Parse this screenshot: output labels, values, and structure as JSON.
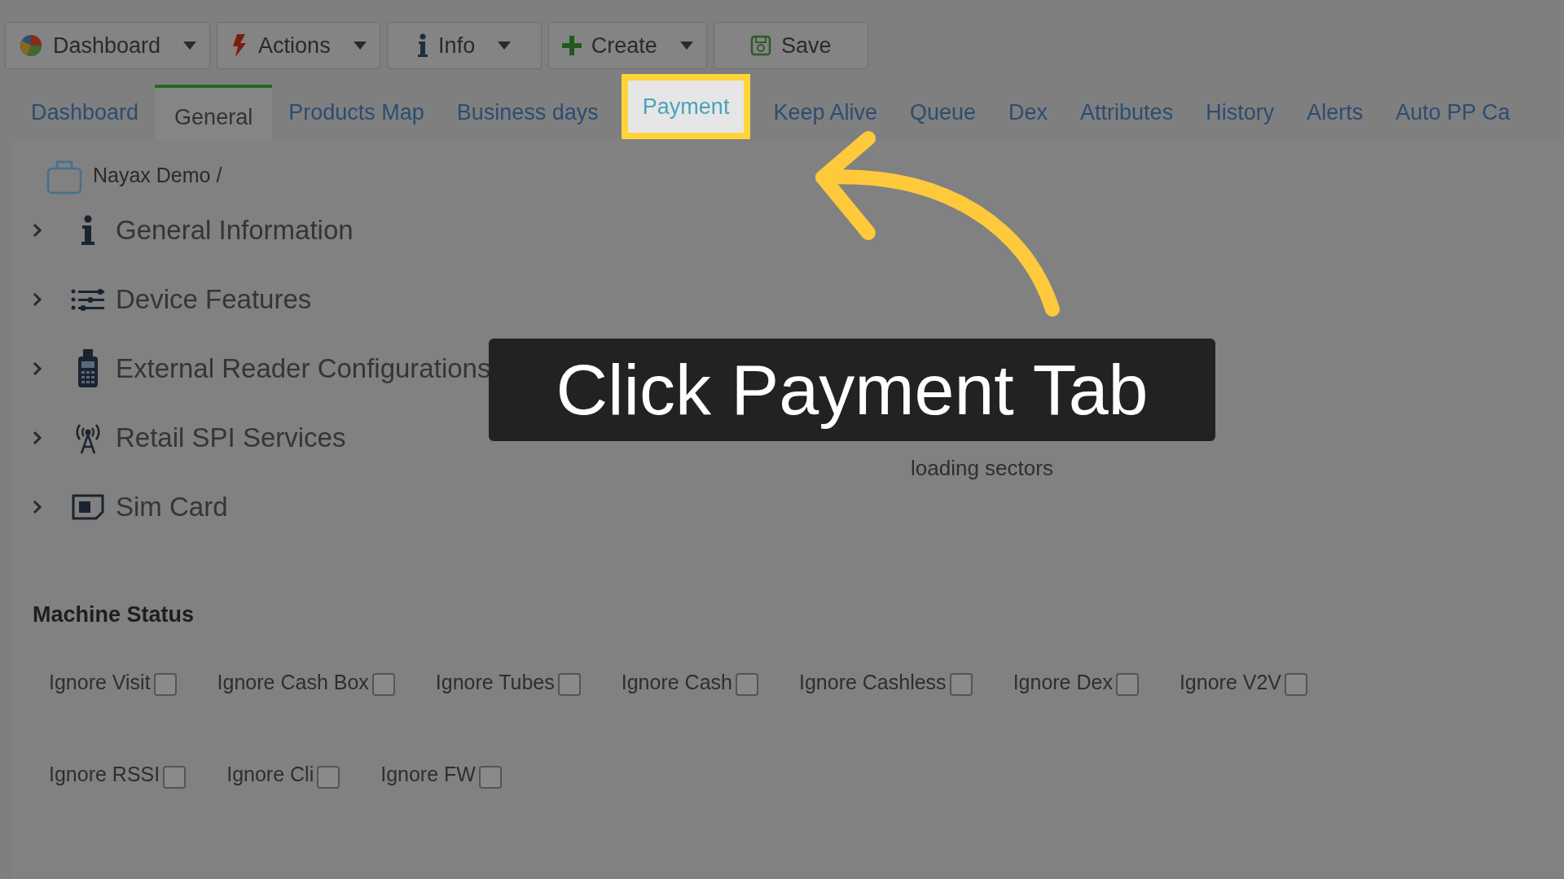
{
  "toolbar": [
    {
      "label": "Dashboard",
      "kind": "chart",
      "has_menu": true
    },
    {
      "label": "Actions",
      "kind": "bolt",
      "has_menu": true
    },
    {
      "label": "Info",
      "kind": "info",
      "has_menu": true
    },
    {
      "label": "Create",
      "kind": "plus",
      "has_menu": true
    },
    {
      "label": "Save",
      "kind": "save",
      "has_menu": false
    }
  ],
  "tabs": [
    {
      "label": "Dashboard",
      "selected": false,
      "highlighted": false
    },
    {
      "label": "General",
      "selected": true,
      "highlighted": false
    },
    {
      "label": "Products Map",
      "selected": false,
      "highlighted": false
    },
    {
      "label": "Business days",
      "selected": false,
      "highlighted": false
    },
    {
      "label": "Payment",
      "selected": false,
      "highlighted": true
    },
    {
      "label": "Keep Alive",
      "selected": false,
      "highlighted": false
    },
    {
      "label": "Queue",
      "selected": false,
      "highlighted": false
    },
    {
      "label": "Dex",
      "selected": false,
      "highlighted": false
    },
    {
      "label": "Attributes",
      "selected": false,
      "highlighted": false
    },
    {
      "label": "History",
      "selected": false,
      "highlighted": false
    },
    {
      "label": "Alerts",
      "selected": false,
      "highlighted": false
    },
    {
      "label": "Auto PP Ca",
      "selected": false,
      "highlighted": false
    }
  ],
  "breadcrumb": "Nayax Demo /",
  "sections": [
    {
      "label": "General Information",
      "kind": "info",
      "expanded": false
    },
    {
      "label": "Device Features",
      "kind": "list",
      "expanded": false
    },
    {
      "label": "External Reader Configurations",
      "kind": "reader",
      "expanded": false
    },
    {
      "label": "Retail SPI Services",
      "kind": "antenna",
      "expanded": false
    },
    {
      "label": "Sim Card",
      "kind": "sim",
      "expanded": false
    }
  ],
  "loading": "loading sectors",
  "machine_status": {
    "title": "Machine Status",
    "rows": [
      [
        {
          "label": "Ignore Visit",
          "checked": false
        },
        {
          "label": "Ignore Cash Box",
          "checked": false
        },
        {
          "label": "Ignore Tubes",
          "checked": false
        },
        {
          "label": "Ignore Cash",
          "checked": false
        },
        {
          "label": "Ignore Cashless",
          "checked": false
        },
        {
          "label": "Ignore Dex",
          "checked": false
        },
        {
          "label": "Ignore V2V",
          "checked": false
        }
      ],
      [
        {
          "label": "Ignore RSSI",
          "checked": false
        },
        {
          "label": "Ignore Cli",
          "checked": false
        },
        {
          "label": "Ignore FW",
          "checked": false
        }
      ]
    ]
  },
  "callout": "Click Payment Tab"
}
